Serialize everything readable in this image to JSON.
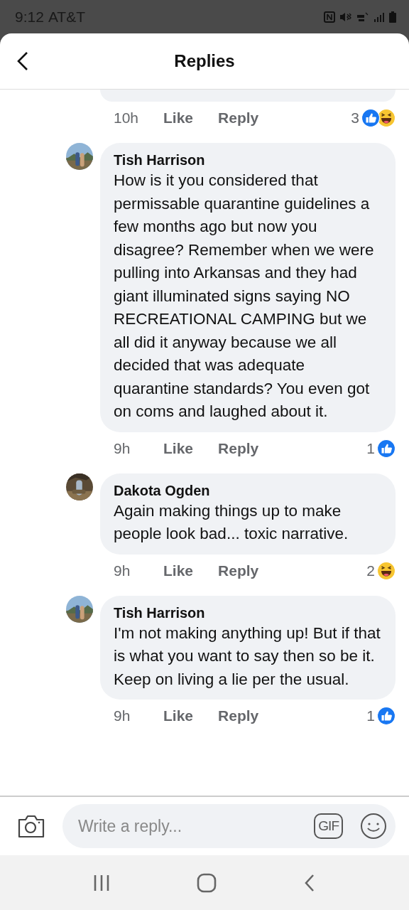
{
  "status_bar": {
    "time": "9:12",
    "carrier": "AT&T"
  },
  "header": {
    "title": "Replies"
  },
  "top_comment": {
    "time": "10h",
    "like": "Like",
    "reply": "Reply",
    "count": "3",
    "reactions": [
      {
        "kind": "like"
      },
      {
        "kind": "haha"
      }
    ]
  },
  "comments": [
    {
      "author": "Tish Harrison",
      "text": "How is it you considered that permissable quarantine guidelines a few months ago but now you disagree? Remember when we were pulling into Arkansas and they had giant illuminated signs saying NO RECREATIONAL CAMPING but we all did it anyway because we all decided that was adequate quarantine standards? You even got on coms and laughed about it.",
      "time": "9h",
      "like": "Like",
      "reply": "Reply",
      "count": "1",
      "reactions": [
        {
          "kind": "like"
        }
      ]
    },
    {
      "author": "Dakota Ogden",
      "text": "Again making things up to make people look bad... toxic narrative.",
      "time": "9h",
      "like": "Like",
      "reply": "Reply",
      "count": "2",
      "reactions": [
        {
          "kind": "haha"
        }
      ]
    },
    {
      "author": "Tish Harrison",
      "text": "I'm not making anything up! But if that is what you want to say then so be it. Keep on living a lie per the usual.",
      "time": "9h",
      "like": "Like",
      "reply": "Reply",
      "count": "1",
      "reactions": [
        {
          "kind": "like"
        }
      ]
    }
  ],
  "composer": {
    "placeholder": "Write a reply...",
    "gif_label": "GIF"
  }
}
